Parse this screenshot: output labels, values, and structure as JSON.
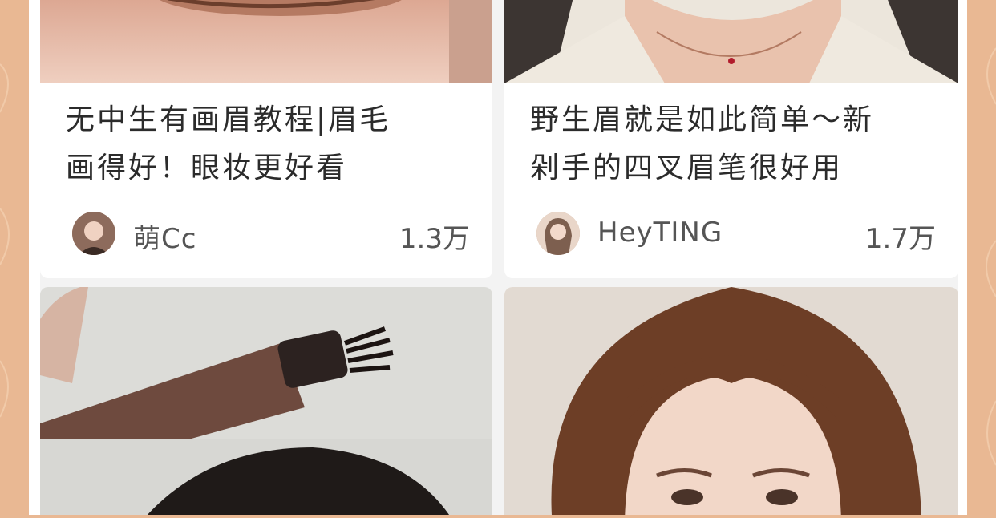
{
  "cards": [
    {
      "title_line1": "无中生有画眉教程|眉毛",
      "title_line2": "画得好！眼妆更好看",
      "author": "萌Cc",
      "views": "1.3万",
      "thumb": "eye-makeup-closeup-photo"
    },
    {
      "title_line1": "野生眉就是如此简单～新",
      "title_line2": "剁手的四叉眉笔很好用",
      "author": "HeyTING",
      "views": "1.7万",
      "thumb": "woman-neck-necklace-photo"
    },
    {
      "thumb": "eyebrow-pen-product-photo"
    },
    {
      "thumb": "woman-face-bangs-photo"
    }
  ],
  "colors": {
    "page_bg": "#e9b893",
    "card_bg": "#ffffff",
    "title_text": "#2b2b2b",
    "meta_text": "#555555"
  }
}
